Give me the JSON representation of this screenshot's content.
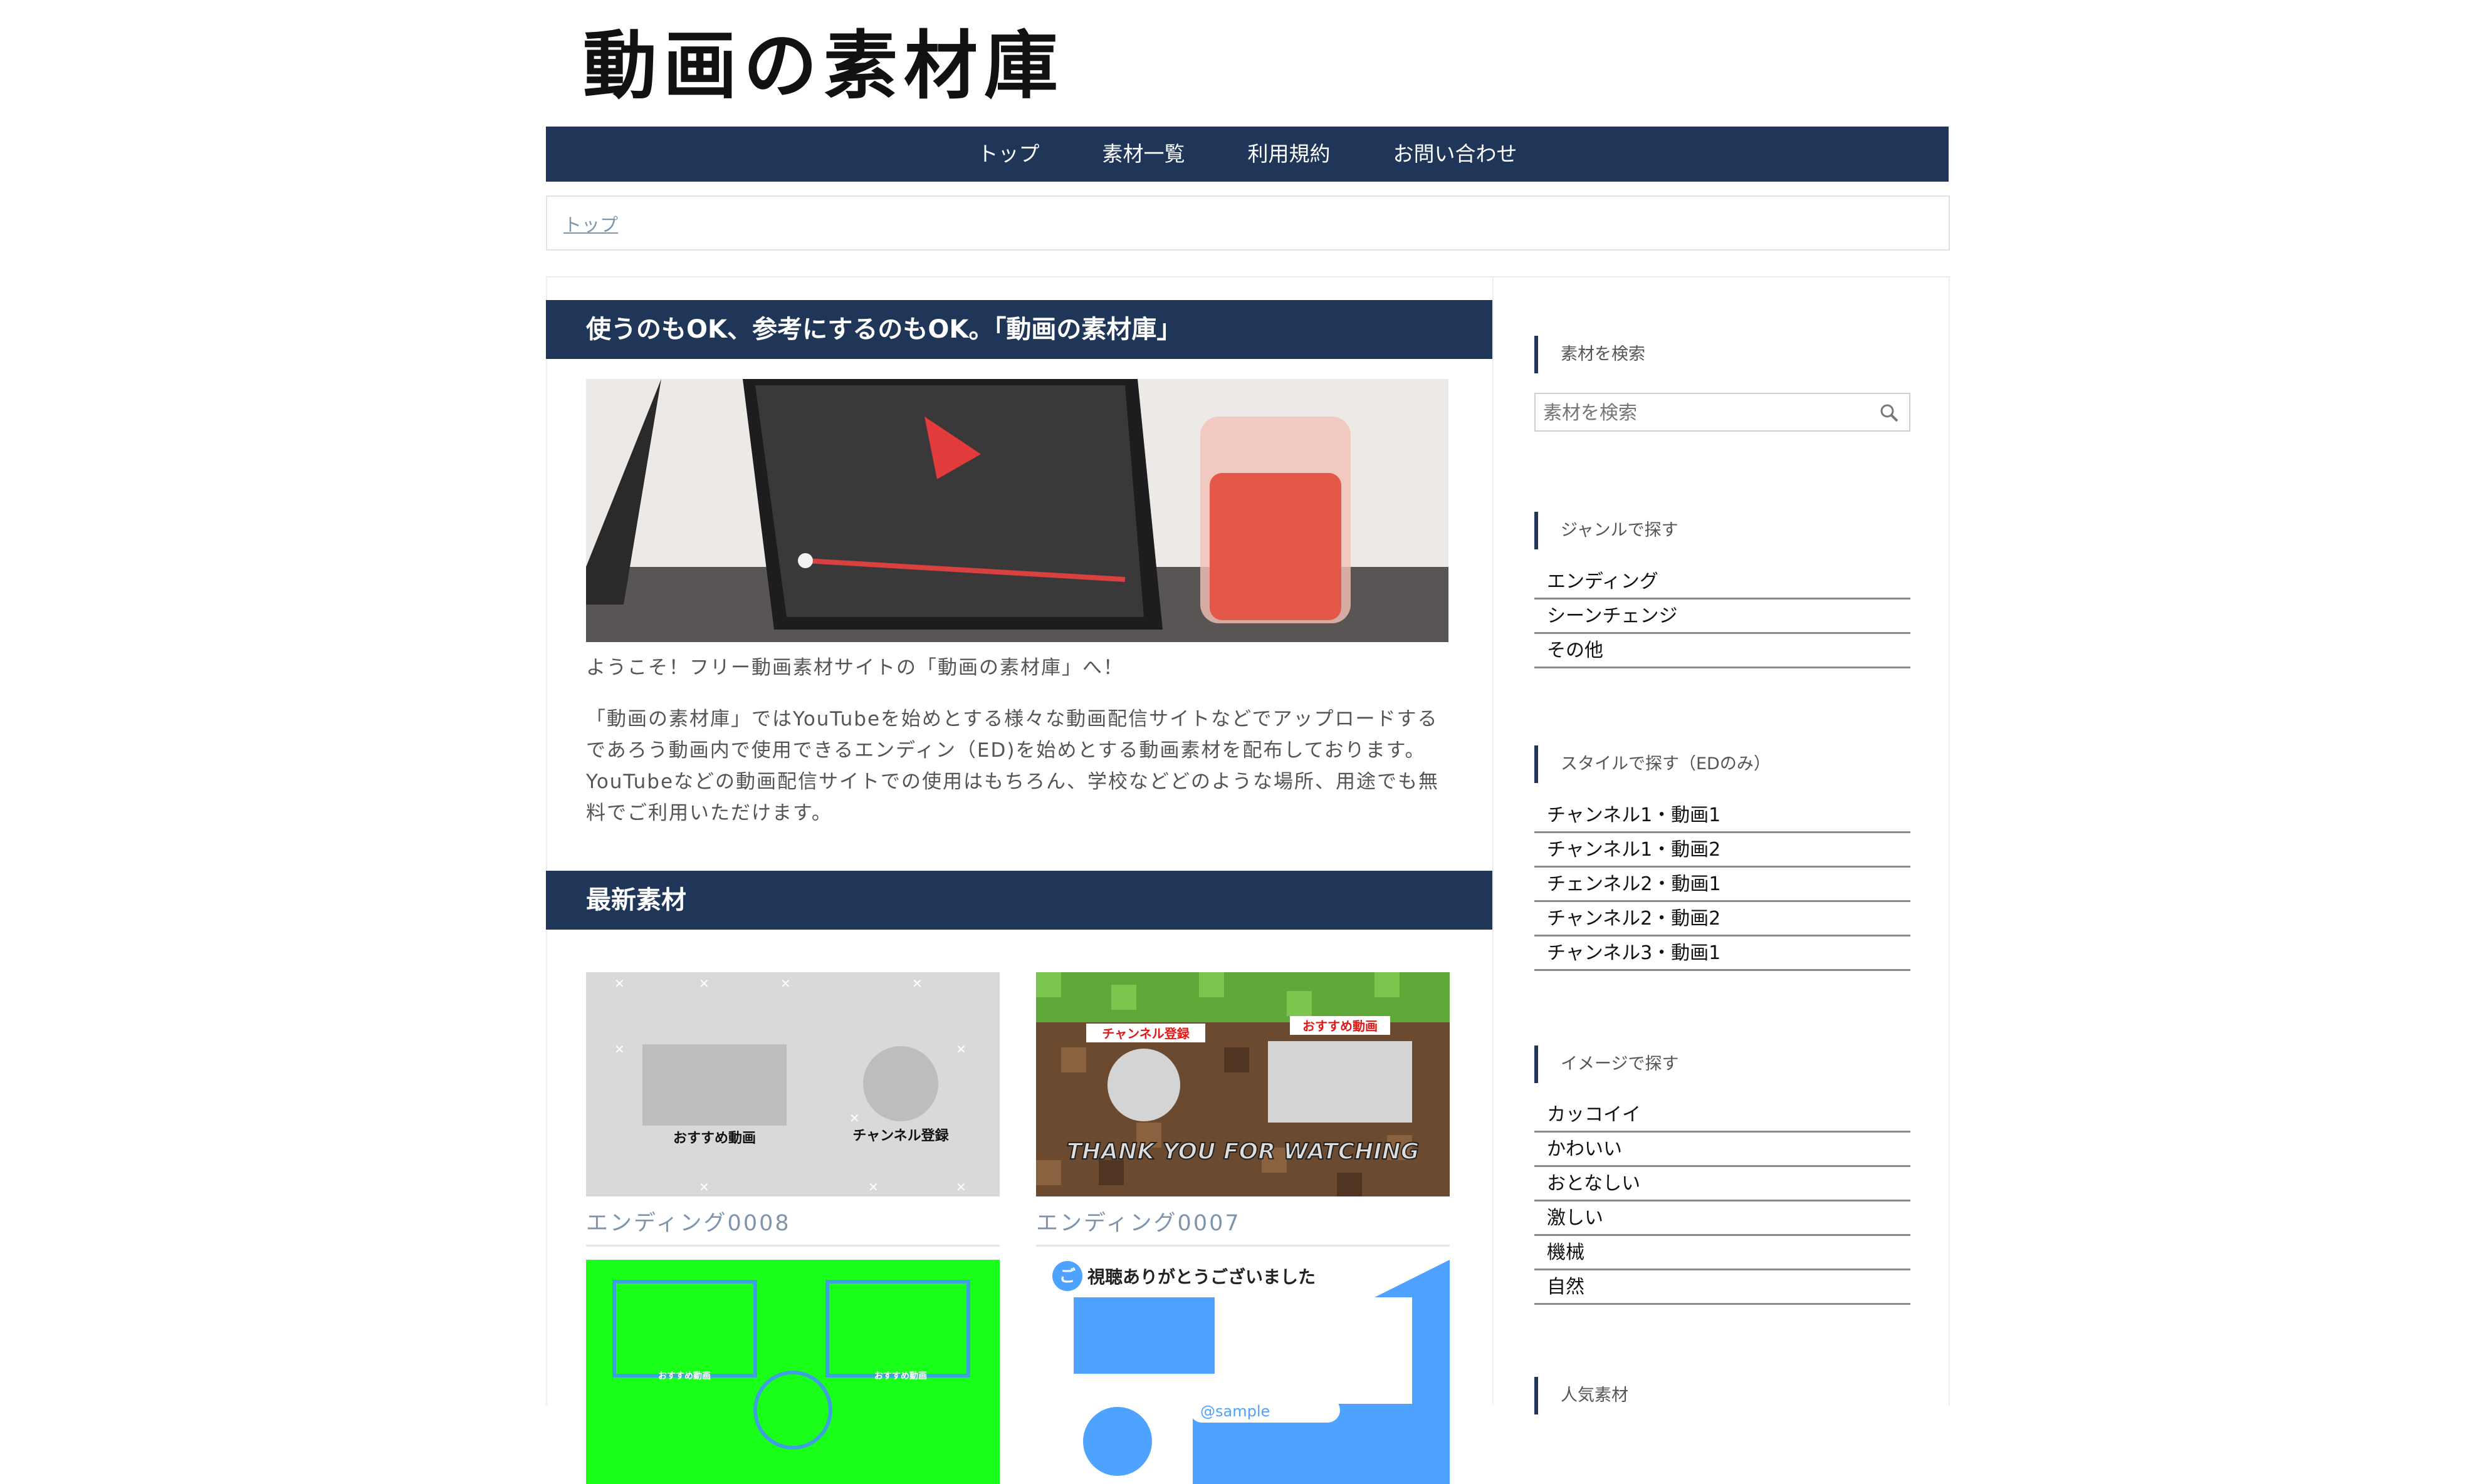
{
  "site": {
    "logo": "動画の素材庫"
  },
  "nav": {
    "items": [
      "トップ",
      "素材一覧",
      "利用規約",
      "お問い合わせ"
    ]
  },
  "breadcrumb": {
    "home": "トップ"
  },
  "main": {
    "heading": "使うのもOK、参考にするのもOK。「動画の素材庫」",
    "welcome": "ようこそ！フリー動画素材サイトの「動画の素材庫」へ！",
    "description": "「動画の素材庫」ではYouTubeを始めとする様々な動画配信サイトなどでアップロードするであろう動画内で使用できるエンディン（ED)を始めとする動画素材を配布しております。YouTubeなどの動画配信サイトでの使用はもちろん、学校などどのような場所、用途でも無料でご利用いただけます。",
    "latest_heading": "最新素材",
    "cards": [
      {
        "title": "エンディング0008",
        "label_video": "おすすめ動画",
        "label_channel": "チャンネル登録"
      },
      {
        "title": "エンディング0007",
        "label_video": "おすすめ動画",
        "label_channel": "チャンネル登録",
        "banner": "THANK YOU FOR WATCHING"
      },
      {
        "label_video": "おすすめ動画",
        "label_video2": "おすすめ動画"
      },
      {
        "caption": "視聴ありがとうございました",
        "badge": "ご",
        "handle": "@sample"
      }
    ]
  },
  "sidebar": {
    "search_heading": "素材を検索",
    "search_placeholder": "素材を検索",
    "genre_heading": "ジャンルで探す",
    "genre_items": [
      "エンディング",
      "シーンチェンジ",
      "その他"
    ],
    "style_heading": "スタイルで探す（EDのみ）",
    "style_items": [
      "チャンネル1・動画1",
      "チャンネル1・動画2",
      "チェンネル2・動画1",
      "チャンネル2・動画2",
      "チャンネル3・動画1"
    ],
    "image_heading": "イメージで探す",
    "image_items": [
      "カッコイイ",
      "かわいい",
      "おとなしい",
      "激しい",
      "機械",
      "自然"
    ],
    "popular_heading": "人気素材"
  },
  "colors": {
    "nav": "#1f3658",
    "link": "#7f95ad",
    "green": "#1aff1a",
    "blue": "#4da3ff"
  }
}
